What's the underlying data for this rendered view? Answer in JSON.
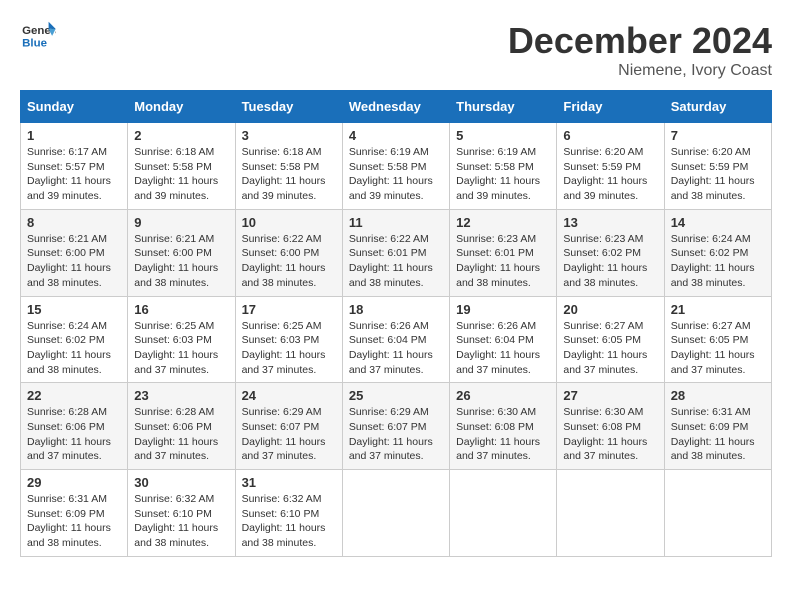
{
  "logo": {
    "line1": "General",
    "line2": "Blue"
  },
  "title": "December 2024",
  "location": "Niemene, Ivory Coast",
  "weekdays": [
    "Sunday",
    "Monday",
    "Tuesday",
    "Wednesday",
    "Thursday",
    "Friday",
    "Saturday"
  ],
  "weeks": [
    [
      {
        "day": "1",
        "sunrise": "6:17 AM",
        "sunset": "5:57 PM",
        "daylight": "11 hours and 39 minutes."
      },
      {
        "day": "2",
        "sunrise": "6:18 AM",
        "sunset": "5:58 PM",
        "daylight": "11 hours and 39 minutes."
      },
      {
        "day": "3",
        "sunrise": "6:18 AM",
        "sunset": "5:58 PM",
        "daylight": "11 hours and 39 minutes."
      },
      {
        "day": "4",
        "sunrise": "6:19 AM",
        "sunset": "5:58 PM",
        "daylight": "11 hours and 39 minutes."
      },
      {
        "day": "5",
        "sunrise": "6:19 AM",
        "sunset": "5:58 PM",
        "daylight": "11 hours and 39 minutes."
      },
      {
        "day": "6",
        "sunrise": "6:20 AM",
        "sunset": "5:59 PM",
        "daylight": "11 hours and 39 minutes."
      },
      {
        "day": "7",
        "sunrise": "6:20 AM",
        "sunset": "5:59 PM",
        "daylight": "11 hours and 38 minutes."
      }
    ],
    [
      {
        "day": "8",
        "sunrise": "6:21 AM",
        "sunset": "6:00 PM",
        "daylight": "11 hours and 38 minutes."
      },
      {
        "day": "9",
        "sunrise": "6:21 AM",
        "sunset": "6:00 PM",
        "daylight": "11 hours and 38 minutes."
      },
      {
        "day": "10",
        "sunrise": "6:22 AM",
        "sunset": "6:00 PM",
        "daylight": "11 hours and 38 minutes."
      },
      {
        "day": "11",
        "sunrise": "6:22 AM",
        "sunset": "6:01 PM",
        "daylight": "11 hours and 38 minutes."
      },
      {
        "day": "12",
        "sunrise": "6:23 AM",
        "sunset": "6:01 PM",
        "daylight": "11 hours and 38 minutes."
      },
      {
        "day": "13",
        "sunrise": "6:23 AM",
        "sunset": "6:02 PM",
        "daylight": "11 hours and 38 minutes."
      },
      {
        "day": "14",
        "sunrise": "6:24 AM",
        "sunset": "6:02 PM",
        "daylight": "11 hours and 38 minutes."
      }
    ],
    [
      {
        "day": "15",
        "sunrise": "6:24 AM",
        "sunset": "6:02 PM",
        "daylight": "11 hours and 38 minutes."
      },
      {
        "day": "16",
        "sunrise": "6:25 AM",
        "sunset": "6:03 PM",
        "daylight": "11 hours and 37 minutes."
      },
      {
        "day": "17",
        "sunrise": "6:25 AM",
        "sunset": "6:03 PM",
        "daylight": "11 hours and 37 minutes."
      },
      {
        "day": "18",
        "sunrise": "6:26 AM",
        "sunset": "6:04 PM",
        "daylight": "11 hours and 37 minutes."
      },
      {
        "day": "19",
        "sunrise": "6:26 AM",
        "sunset": "6:04 PM",
        "daylight": "11 hours and 37 minutes."
      },
      {
        "day": "20",
        "sunrise": "6:27 AM",
        "sunset": "6:05 PM",
        "daylight": "11 hours and 37 minutes."
      },
      {
        "day": "21",
        "sunrise": "6:27 AM",
        "sunset": "6:05 PM",
        "daylight": "11 hours and 37 minutes."
      }
    ],
    [
      {
        "day": "22",
        "sunrise": "6:28 AM",
        "sunset": "6:06 PM",
        "daylight": "11 hours and 37 minutes."
      },
      {
        "day": "23",
        "sunrise": "6:28 AM",
        "sunset": "6:06 PM",
        "daylight": "11 hours and 37 minutes."
      },
      {
        "day": "24",
        "sunrise": "6:29 AM",
        "sunset": "6:07 PM",
        "daylight": "11 hours and 37 minutes."
      },
      {
        "day": "25",
        "sunrise": "6:29 AM",
        "sunset": "6:07 PM",
        "daylight": "11 hours and 37 minutes."
      },
      {
        "day": "26",
        "sunrise": "6:30 AM",
        "sunset": "6:08 PM",
        "daylight": "11 hours and 37 minutes."
      },
      {
        "day": "27",
        "sunrise": "6:30 AM",
        "sunset": "6:08 PM",
        "daylight": "11 hours and 37 minutes."
      },
      {
        "day": "28",
        "sunrise": "6:31 AM",
        "sunset": "6:09 PM",
        "daylight": "11 hours and 38 minutes."
      }
    ],
    [
      {
        "day": "29",
        "sunrise": "6:31 AM",
        "sunset": "6:09 PM",
        "daylight": "11 hours and 38 minutes."
      },
      {
        "day": "30",
        "sunrise": "6:32 AM",
        "sunset": "6:10 PM",
        "daylight": "11 hours and 38 minutes."
      },
      {
        "day": "31",
        "sunrise": "6:32 AM",
        "sunset": "6:10 PM",
        "daylight": "11 hours and 38 minutes."
      },
      null,
      null,
      null,
      null
    ]
  ]
}
